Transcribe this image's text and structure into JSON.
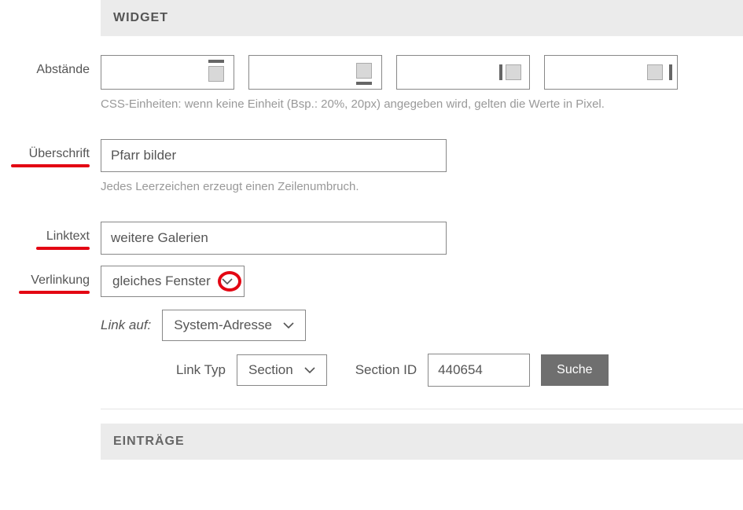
{
  "sections": {
    "widget_title": "WIDGET",
    "entries_title": "EINTRÄGE"
  },
  "spacing": {
    "label": "Abstände",
    "hint": "CSS-Einheiten: wenn keine Einheit (Bsp.: 20%, 20px) angegeben wird, gelten die Werte in Pixel.",
    "values": {
      "top": "",
      "bottom": "",
      "left": "",
      "right": ""
    }
  },
  "heading": {
    "label": "Überschrift",
    "value": "Pfarr bilder",
    "hint": "Jedes Leerzeichen erzeugt einen Zeilenumbruch."
  },
  "linktext": {
    "label": "Linktext",
    "value": "weitere Galerien"
  },
  "linking": {
    "label": "Verlinkung",
    "window_value": "gleiches Fenster",
    "link_on_label": "Link auf:",
    "link_on_value": "System-Adresse",
    "link_typ_label": "Link Typ",
    "link_typ_value": "Section",
    "section_id_label": "Section ID",
    "section_id_value": "440654",
    "search_button": "Suche"
  }
}
